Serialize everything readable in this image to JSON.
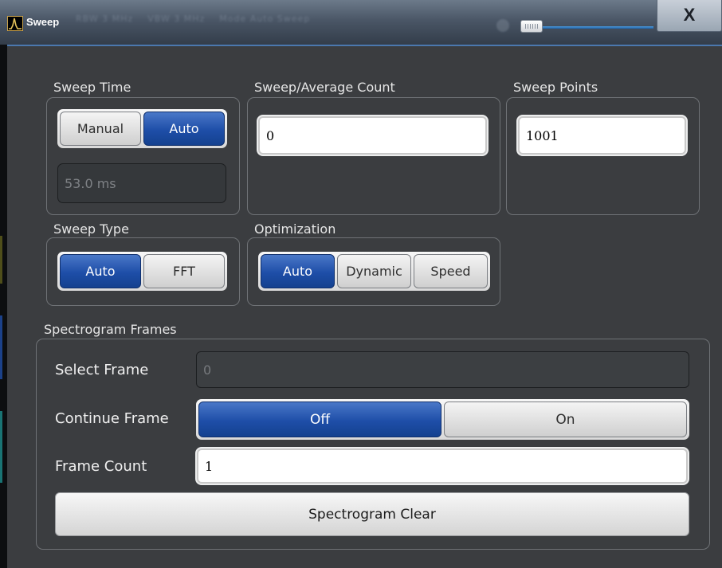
{
  "window": {
    "title": "Sweep",
    "close_label": "X",
    "app_icon": "spectrum-analyzer-icon",
    "background_hint": [
      "RBW 3 MHz",
      "VBW 3 MHz",
      "Mode Auto Sweep"
    ]
  },
  "sweep_time": {
    "label": "Sweep Time",
    "options": [
      "Manual",
      "Auto"
    ],
    "selected": "Auto",
    "value": "53.0 ms"
  },
  "sweep_avg_count": {
    "label": "Sweep/Average Count",
    "value": "0"
  },
  "sweep_points": {
    "label": "Sweep Points",
    "value": "1001"
  },
  "sweep_type": {
    "label": "Sweep Type",
    "options": [
      "Auto",
      "FFT"
    ],
    "selected": "Auto"
  },
  "optimization": {
    "label": "Optimization",
    "options": [
      "Auto",
      "Dynamic",
      "Speed"
    ],
    "selected": "Auto"
  },
  "spectrogram": {
    "label": "Spectrogram Frames",
    "select_frame_label": "Select Frame",
    "select_frame_value": "0",
    "continue_frame_label": "Continue Frame",
    "continue_options": [
      "Off",
      "On"
    ],
    "continue_selected": "Off",
    "frame_count_label": "Frame Count",
    "frame_count_value": "1",
    "clear_label": "Spectrogram Clear"
  },
  "colors": {
    "accent": "#1e4ea8",
    "panel": "#3b3d40",
    "titlebar": "#4a5666"
  }
}
